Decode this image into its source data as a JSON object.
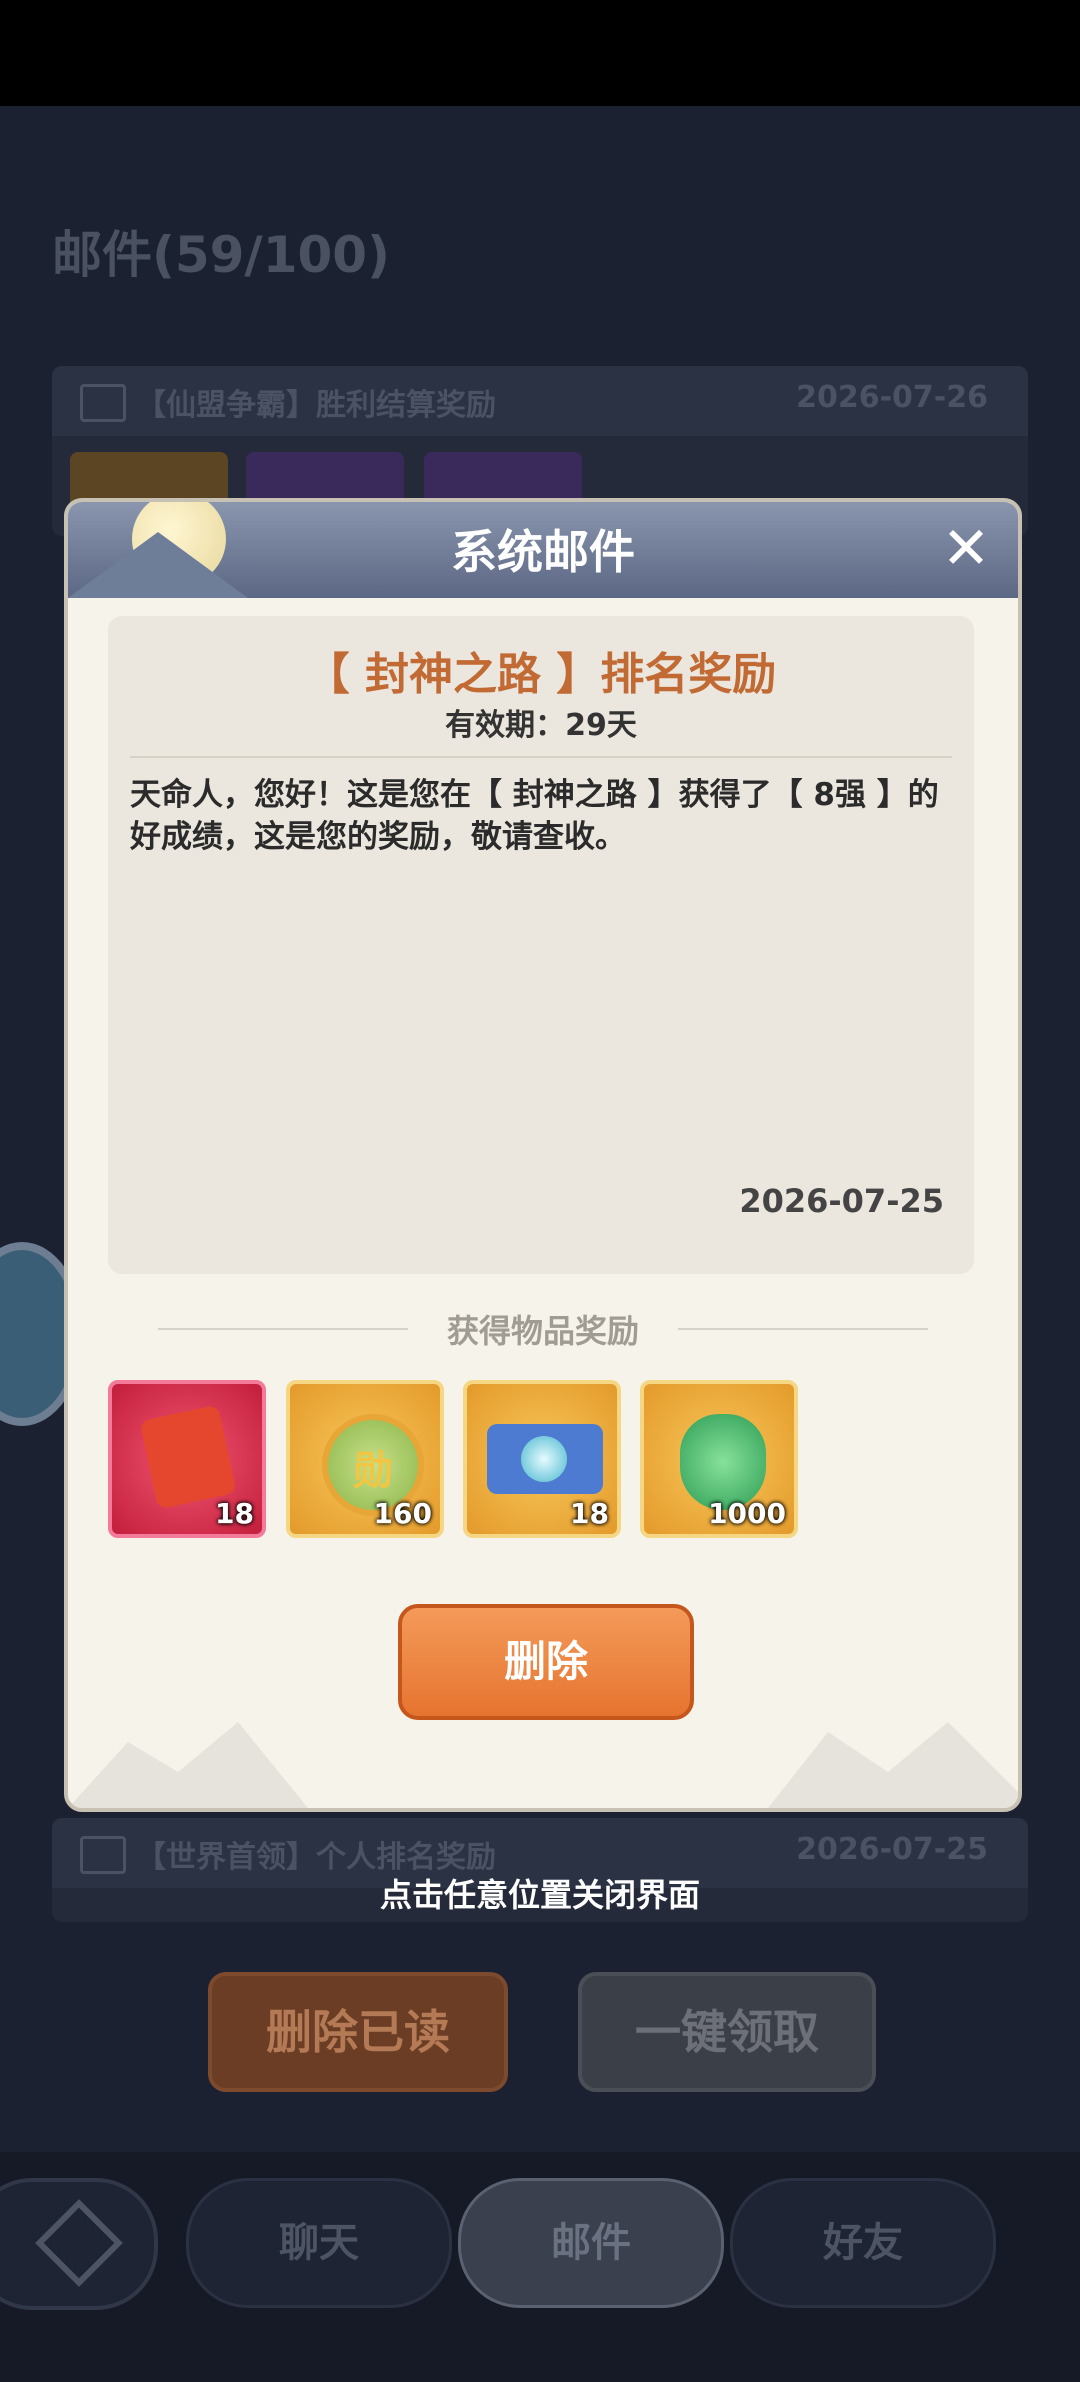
{
  "background": {
    "title": "邮件(59/100)",
    "mails": [
      {
        "subject": "【仙盟争霸】胜利结算奖励",
        "date": "2026-07-26"
      },
      {
        "subject": "【世界首领】个人排名奖励",
        "date": "2026-07-25"
      }
    ],
    "delete_read_label": "删除已读",
    "claim_all_label": "一键领取"
  },
  "nav": {
    "tabs": [
      "聊天",
      "邮件",
      "好友"
    ],
    "active": "邮件"
  },
  "modal": {
    "title": "系统邮件",
    "subject": "【 封神之路 】排名奖励",
    "validity": "有效期：29天",
    "body": "天命人，您好！这是您在【 封神之路 】获得了【 8强 】的好成绩，这是您的奖励，敬请查收。",
    "date": "2026-07-25",
    "rewards_title": "获得物品奖励",
    "rewards": [
      {
        "icon": "puzzle-piece-icon",
        "count": "18"
      },
      {
        "icon": "medal-coin-icon",
        "count": "160",
        "glyph": "勋"
      },
      {
        "icon": "scroll-icon",
        "count": "18"
      },
      {
        "icon": "jade-dragon-icon",
        "count": "1000"
      }
    ],
    "delete_label": "删除"
  },
  "hint": "点击任意位置关闭界面"
}
